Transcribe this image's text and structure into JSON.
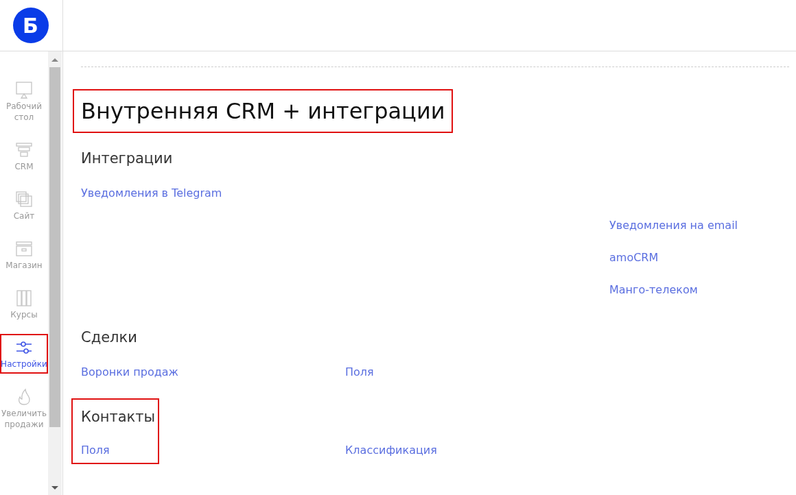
{
  "logo": {
    "letter": "Б"
  },
  "nav": [
    {
      "label": "Рабочий стол",
      "selected": false,
      "highlighted": false
    },
    {
      "label": "CRM",
      "selected": false,
      "highlighted": false
    },
    {
      "label": "Сайт",
      "selected": false,
      "highlighted": false
    },
    {
      "label": "Магазин",
      "selected": false,
      "highlighted": false
    },
    {
      "label": "Курсы",
      "selected": false,
      "highlighted": false
    },
    {
      "label": "Настройки",
      "selected": true,
      "highlighted": true
    },
    {
      "label": "Увеличить продажи",
      "selected": false,
      "highlighted": false
    }
  ],
  "page": {
    "title": "Внутренняя CRM + интеграции",
    "title_highlighted": true
  },
  "sections": [
    {
      "heading": "Интеграции",
      "highlighted": false,
      "rows": [
        [
          "Уведомления в Telegram",
          null,
          null
        ],
        [
          null,
          null,
          "Уведомления на email"
        ],
        [
          null,
          null,
          "amoCRM"
        ],
        [
          null,
          null,
          "Манго-телеком"
        ]
      ]
    },
    {
      "heading": "Сделки",
      "highlighted": false,
      "rows": [
        [
          "Воронки продаж",
          "Поля",
          null
        ]
      ]
    },
    {
      "heading": "Контакты",
      "highlighted": true,
      "rows": [
        [
          "Поля",
          "Классификация",
          null
        ]
      ]
    }
  ]
}
